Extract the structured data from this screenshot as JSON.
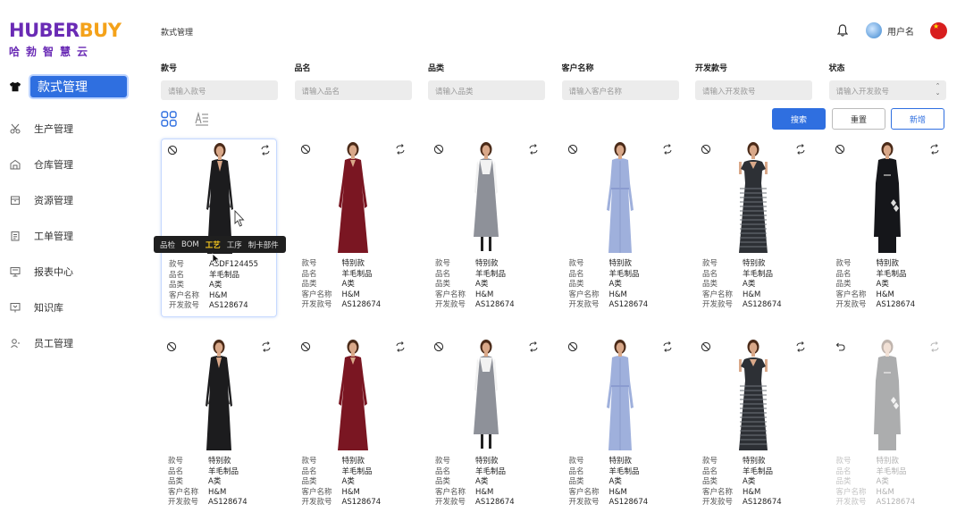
{
  "logo": {
    "brand_a": "HUBER",
    "brand_b": "BUY",
    "subtitle": "哈勃智慧云",
    "colors": {
      "purple": "#6a2bb5",
      "orange": "#f4a21a"
    }
  },
  "sidebar": {
    "items": [
      {
        "label": "款式管理",
        "icon": "shirt-icon",
        "active": true
      },
      {
        "label": "生产管理",
        "icon": "scissors-icon"
      },
      {
        "label": "仓库管理",
        "icon": "warehouse-icon"
      },
      {
        "label": "资源管理",
        "icon": "box-icon"
      },
      {
        "label": "工单管理",
        "icon": "clipboard-icon"
      },
      {
        "label": "报表中心",
        "icon": "report-icon"
      },
      {
        "label": "知识库",
        "icon": "book-icon"
      },
      {
        "label": "员工管理",
        "icon": "user-icon"
      }
    ]
  },
  "header": {
    "breadcrumb": "款式管理",
    "username": "用户名"
  },
  "filters": [
    {
      "label": "款号",
      "placeholder": "请输入款号"
    },
    {
      "label": "品名",
      "placeholder": "请输入品名"
    },
    {
      "label": "品类",
      "placeholder": "请输入品类"
    },
    {
      "label": "客户名称",
      "placeholder": "请输入客户名称"
    },
    {
      "label": "开发款号",
      "placeholder": "请输入开发款号"
    },
    {
      "label": "状态",
      "placeholder": "请输入开发款号"
    }
  ],
  "buttons": {
    "search": "搜索",
    "reset": "重置",
    "add": "新增"
  },
  "field_labels": {
    "style_no": "款号",
    "name": "品名",
    "category": "品类",
    "customer": "客户名称",
    "dev_no": "开发款号"
  },
  "tooltip": {
    "items": [
      "品检",
      "BOM",
      "工艺",
      "工序",
      "制卡部件"
    ],
    "selected": "工艺"
  },
  "cards": [
    {
      "style_no": "ASDF124455",
      "name": "羊毛制品",
      "category": "A类",
      "customer": "H&M",
      "dev_no": "AS128674",
      "dress": "black-long"
    },
    {
      "style_no": "特别款",
      "name": "羊毛制品",
      "category": "A类",
      "customer": "H&M",
      "dev_no": "AS128674",
      "dress": "red"
    },
    {
      "style_no": "特别款",
      "name": "羊毛制品",
      "category": "A类",
      "customer": "H&M",
      "dev_no": "AS128674",
      "dress": "grey"
    },
    {
      "style_no": "特别款",
      "name": "羊毛制品",
      "category": "A类",
      "customer": "H&M",
      "dev_no": "AS128674",
      "dress": "blue"
    },
    {
      "style_no": "特别款",
      "name": "羊毛制品",
      "category": "A类",
      "customer": "H&M",
      "dev_no": "AS128674",
      "dress": "stripe"
    },
    {
      "style_no": "特别款",
      "name": "羊毛制品",
      "category": "A类",
      "customer": "H&M",
      "dev_no": "AS128674",
      "dress": "black-short"
    },
    {
      "style_no": "特别款",
      "name": "羊毛制品",
      "category": "A类",
      "customer": "H&M",
      "dev_no": "AS128674",
      "dress": "black-long"
    },
    {
      "style_no": "特别款",
      "name": "羊毛制品",
      "category": "A类",
      "customer": "H&M",
      "dev_no": "AS128674",
      "dress": "red"
    },
    {
      "style_no": "特别款",
      "name": "羊毛制品",
      "category": "A类",
      "customer": "H&M",
      "dev_no": "AS128674",
      "dress": "grey"
    },
    {
      "style_no": "特别款",
      "name": "羊毛制品",
      "category": "A类",
      "customer": "H&M",
      "dev_no": "AS128674",
      "dress": "blue"
    },
    {
      "style_no": "特别款",
      "name": "羊毛制品",
      "category": "A类",
      "customer": "H&M",
      "dev_no": "AS128674",
      "dress": "stripe"
    },
    {
      "style_no": "特别款",
      "name": "羊毛制品",
      "category": "A类",
      "customer": "H&M",
      "dev_no": "AS128674",
      "dress": "black-short",
      "faded": true
    }
  ],
  "colors": {
    "accent": "#2f6fe0",
    "input_bg": "#ececec"
  }
}
